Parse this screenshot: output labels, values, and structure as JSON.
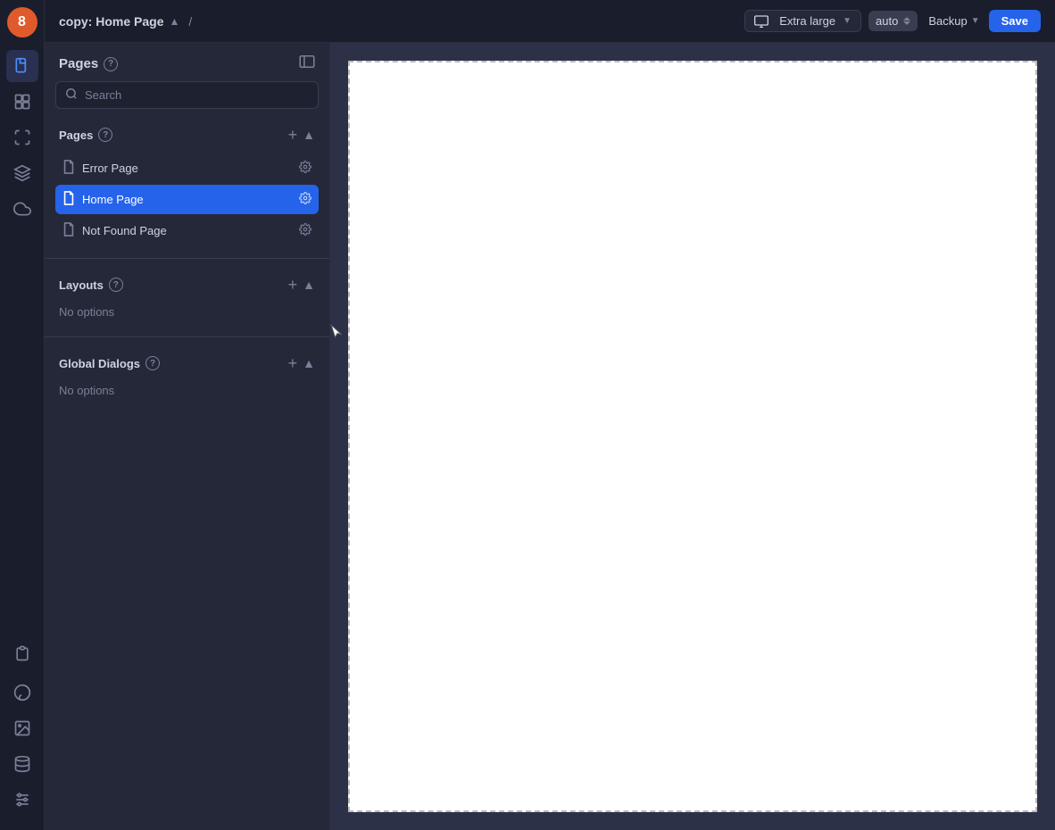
{
  "header": {
    "project_name": "copy: Home Page",
    "slash": "/",
    "viewport_label": "Extra large",
    "viewport_icon": "monitor-icon",
    "auto_label": "auto",
    "backup_label": "Backup",
    "save_label": "Save"
  },
  "left_panel": {
    "title": "Pages",
    "search_placeholder": "Search",
    "pages_section": {
      "title": "Pages",
      "items": [
        {
          "label": "Error Page",
          "active": false
        },
        {
          "label": "Home Page",
          "active": true
        },
        {
          "label": "Not Found Page",
          "active": false
        }
      ]
    },
    "layouts_section": {
      "title": "Layouts",
      "no_options": "No options"
    },
    "global_dialogs_section": {
      "title": "Global Dialogs",
      "no_options": "No options"
    }
  },
  "rail": {
    "logo_text": "8",
    "icons": [
      "pages",
      "components",
      "variables",
      "layers",
      "cloud",
      "functions"
    ]
  }
}
